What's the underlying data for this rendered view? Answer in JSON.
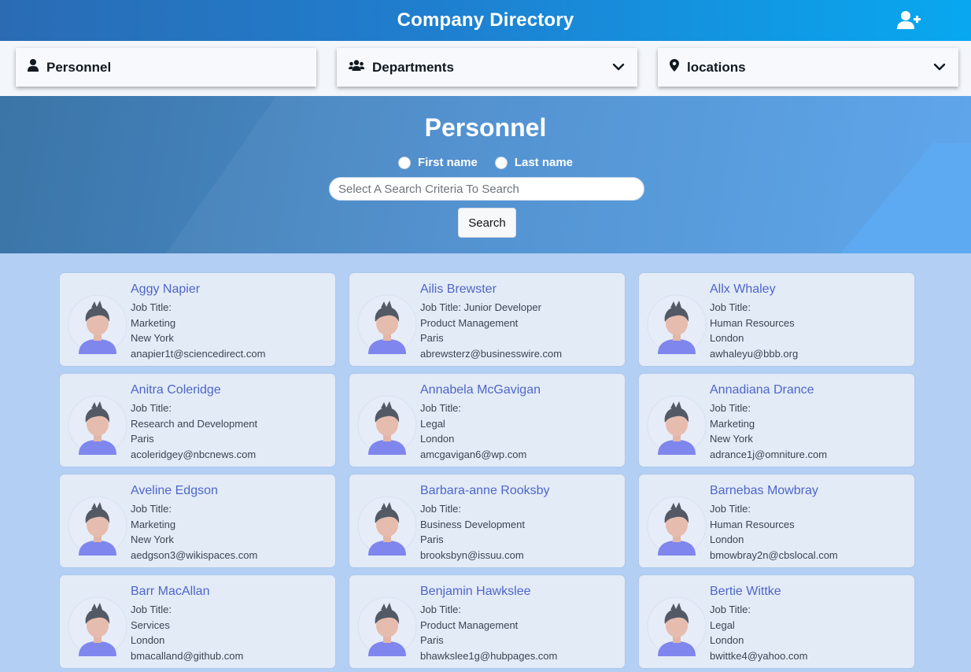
{
  "header": {
    "title": "Company Directory",
    "add_icon": "user-plus-icon"
  },
  "nav": [
    {
      "label": "Personnel",
      "icon": "user-icon",
      "dropdown": false
    },
    {
      "label": "Departments",
      "icon": "users-icon",
      "dropdown": true
    },
    {
      "label": "locations",
      "icon": "map-pin-icon",
      "dropdown": true
    }
  ],
  "search": {
    "title": "Personnel",
    "radio_first": "First name",
    "radio_last": "Last name",
    "placeholder": "Select A Search Criteria To Search",
    "button": "Search"
  },
  "employees": [
    {
      "name": "Aggy Napier",
      "job": "Job Title:",
      "department": "Marketing",
      "location": "New York",
      "email": "anapier1t@sciencedirect.com"
    },
    {
      "name": "Ailis Brewster",
      "job": "Job Title: Junior Developer",
      "department": "Product Management",
      "location": "Paris",
      "email": "abrewsterz@businesswire.com"
    },
    {
      "name": "Allx Whaley",
      "job": "Job Title:",
      "department": "Human Resources",
      "location": "London",
      "email": "awhaleyu@bbb.org"
    },
    {
      "name": "Anitra Coleridge",
      "job": "Job Title:",
      "department": "Research and Development",
      "location": "Paris",
      "email": "acoleridgey@nbcnews.com"
    },
    {
      "name": "Annabela McGavigan",
      "job": "Job Title:",
      "department": "Legal",
      "location": "London",
      "email": "amcgavigan6@wp.com"
    },
    {
      "name": "Annadiana Drance",
      "job": "Job Title:",
      "department": "Marketing",
      "location": "New York",
      "email": "adrance1j@omniture.com"
    },
    {
      "name": "Aveline Edgson",
      "job": "Job Title:",
      "department": "Marketing",
      "location": "New York",
      "email": "aedgson3@wikispaces.com"
    },
    {
      "name": "Barbara-anne Rooksby",
      "job": "Job Title:",
      "department": "Business Development",
      "location": "Paris",
      "email": "brooksbyn@issuu.com"
    },
    {
      "name": "Barnebas Mowbray",
      "job": "Job Title:",
      "department": "Human Resources",
      "location": "London",
      "email": "bmowbray2n@cbslocal.com"
    },
    {
      "name": "Barr MacAllan",
      "job": "Job Title:",
      "department": "Services",
      "location": "London",
      "email": "bmacalland@github.com"
    },
    {
      "name": "Benjamin Hawkslee",
      "job": "Job Title:",
      "department": "Product Management",
      "location": "Paris",
      "email": "bhawkslee1g@hubpages.com"
    },
    {
      "name": "Bertie Wittke",
      "job": "Job Title:",
      "department": "Legal",
      "location": "London",
      "email": "bwittke4@yahoo.com"
    }
  ]
}
